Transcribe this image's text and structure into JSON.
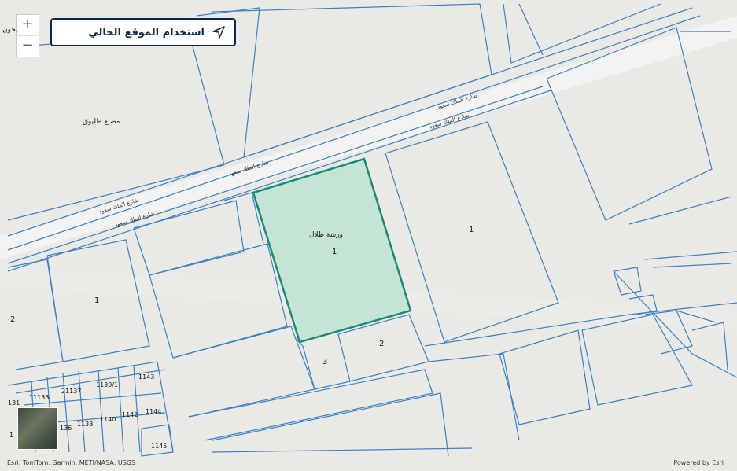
{
  "locate_button": {
    "label": "استخدام الموقع الحالي",
    "icon": "navigation-arrow-icon"
  },
  "zoom": {
    "in_label": "+",
    "out_label": "−"
  },
  "place_labels": {
    "factory": "مصنع طليوق",
    "corner_top_left": "يخون",
    "parcel_name": "ورشة ظلال"
  },
  "street_labels": {
    "king_saud_1": "شارع الملك سعود",
    "king_saud_2": "شارع الملك سعود",
    "king_saud_3": "شارع الملك سعود",
    "king_saud_4": "شارع الملك سعود",
    "king_saud_5": "شارع الملك سعود"
  },
  "parcel_numbers": {
    "highlighted": "1",
    "right_large": "1",
    "left_mid": "1",
    "far_left": "2",
    "south_2": "2",
    "south_3": "3",
    "n1143": "1143",
    "n1139": "1139/1",
    "n1137": "21137",
    "n1133": "11133",
    "n131": "131",
    "n1144": "1144",
    "n1142": "1142",
    "n1140": "1140",
    "n1138": "1138",
    "n136": "136",
    "n1": "1",
    "n1145": "1145"
  },
  "attribution": "Esri, TomTom, Garmin, METI/NASA, USGS",
  "powered_by": "Powered by Esri",
  "colors": {
    "parcel_line": "#3a82c4",
    "highlight_fill": "#bfe3cf",
    "highlight_stroke": "#1a8a78",
    "button_border": "#0e2a47"
  }
}
